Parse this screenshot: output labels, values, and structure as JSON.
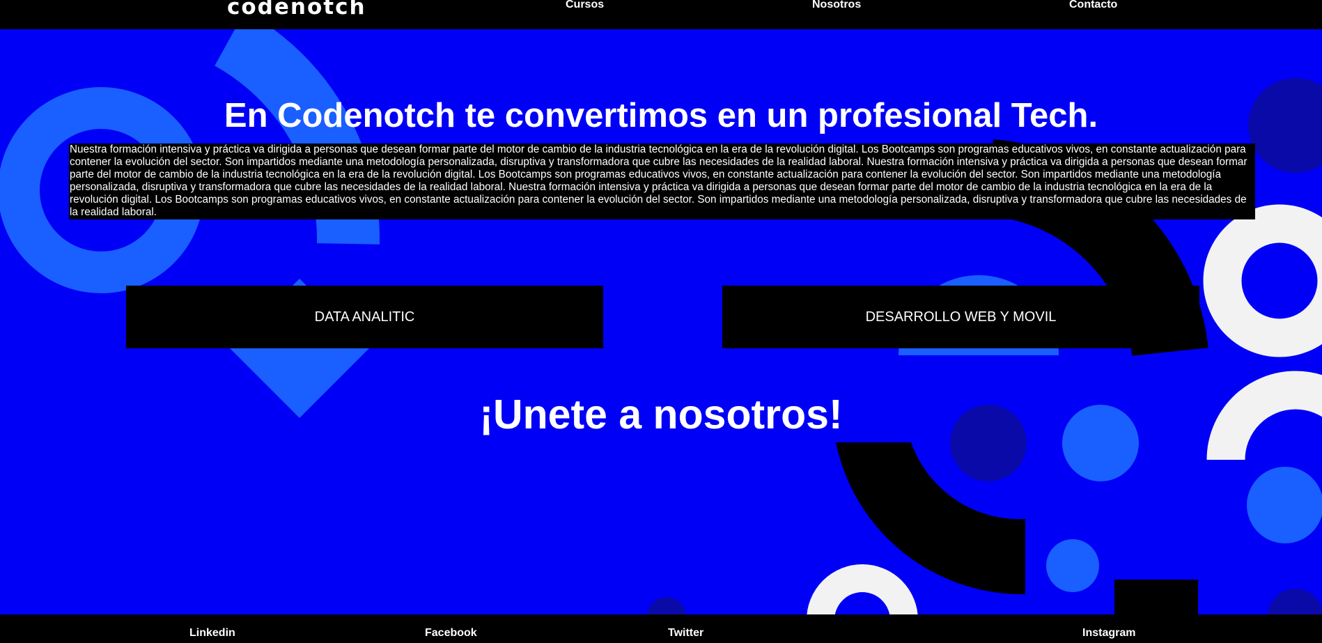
{
  "header": {
    "logo": "codenotch",
    "nav": [
      "Cursos",
      "Nosotros",
      "Contacto"
    ]
  },
  "hero": {
    "title": "En Codenotch te convertimos en un profesional Tech.",
    "description": "Nuestra formación intensiva y práctica va dirigida a personas que desean formar parte del motor de cambio de la industria tecnológica en la era de la revolución digital. Los Bootcamps son programas educativos vivos, en constante actualización para contener la evolución del sector. Son impartidos mediante una metodología personalizada, disruptiva y transformadora que cubre las necesidades de la realidad laboral. Nuestra formación intensiva y práctica va dirigida a personas que desean formar parte del motor de cambio de la industria tecnológica en la era de la revolución digital. Los Bootcamps son programas educativos vivos, en constante actualización para contener la evolución del sector. Son impartidos mediante una metodología personalizada, disruptiva y transformadora que cubre las necesidades de la realidad laboral. Nuestra formación intensiva y práctica va dirigida a personas que desean formar parte del motor de cambio de la industria tecnológica en la era de la revolución digital. Los Bootcamps son programas educativos vivos, en constante actualización para contener la evolución del sector. Son impartidos mediante una metodología personalizada, disruptiva y transformadora que cubre las necesidades de la realidad laboral."
  },
  "courses": [
    "DATA ANALITIC",
    "DESARROLLO WEB Y MOVIL"
  ],
  "join": "¡Unete a nosotros!",
  "footer": {
    "links": [
      "Linkedin",
      "Facebook",
      "Twitter",
      "Instagram"
    ]
  },
  "colors": {
    "background": "#0000f7",
    "bars": "#000000",
    "shape_light_blue": "#1a5fff",
    "shape_dark_blue": "#0a0aa8",
    "shape_white": "#f2f2f2"
  }
}
